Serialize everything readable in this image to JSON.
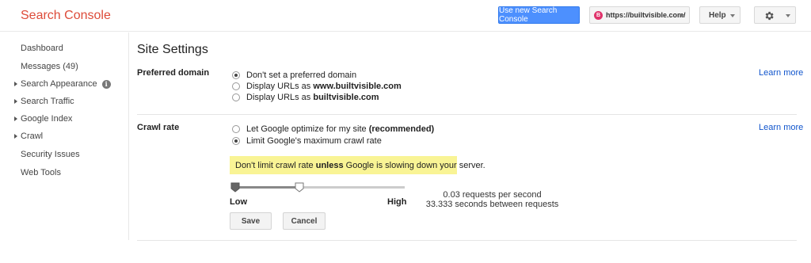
{
  "header": {
    "brand": "Search Console",
    "new_console_button": "Use new Search Console",
    "site": {
      "badge": "B",
      "url": "https://builtvisible.com/"
    },
    "help_label": "Help"
  },
  "sidebar": {
    "items": [
      {
        "label": "Dashboard",
        "expandable": false
      },
      {
        "label": "Messages (49)",
        "expandable": false
      },
      {
        "label": "Search Appearance",
        "expandable": true,
        "info": "i"
      },
      {
        "label": "Search Traffic",
        "expandable": true
      },
      {
        "label": "Google Index",
        "expandable": true
      },
      {
        "label": "Crawl",
        "expandable": true
      },
      {
        "label": "Security Issues",
        "expandable": false
      },
      {
        "label": "Web Tools",
        "expandable": false
      }
    ]
  },
  "main": {
    "title": "Site Settings",
    "preferred_domain": {
      "label": "Preferred domain",
      "learn_more": "Learn more",
      "options": [
        {
          "prefix": "Don't set a preferred domain",
          "bold": "",
          "checked": true
        },
        {
          "prefix": "Display URLs as ",
          "bold": "www.builtvisible.com",
          "checked": false
        },
        {
          "prefix": "Display URLs as ",
          "bold": "builtvisible.com",
          "checked": false
        }
      ]
    },
    "crawl_rate": {
      "label": "Crawl rate",
      "learn_more": "Learn more",
      "options": [
        {
          "prefix": "Let Google optimize for my site ",
          "bold": "(recommended)",
          "checked": false
        },
        {
          "prefix": "Limit Google's maximum crawl rate",
          "bold": "",
          "checked": true
        }
      ],
      "notice": {
        "before": "Don't limit crawl rate ",
        "bold": "unless",
        "after": " Google is slowing down your server."
      },
      "slider": {
        "low_label": "Low",
        "high_label": "High",
        "value_fraction": 0.39
      },
      "requests_per_second": "0.03 requests per second",
      "seconds_between": "33.333 seconds between requests",
      "save_label": "Save",
      "cancel_label": "Cancel"
    }
  }
}
